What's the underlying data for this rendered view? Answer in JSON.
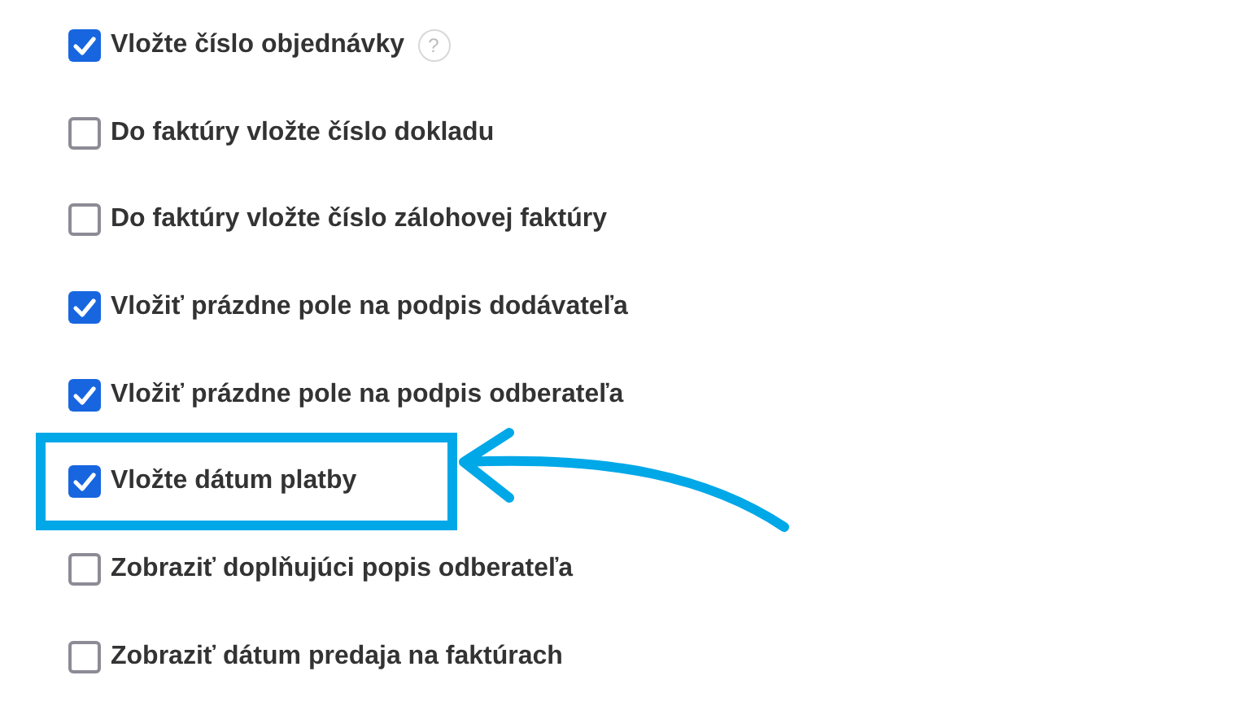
{
  "options": [
    {
      "label": "Vložte číslo objednávky",
      "checked": true,
      "help": "?",
      "highlighted": false
    },
    {
      "label": "Do faktúry vložte číslo dokladu",
      "checked": false,
      "highlighted": false
    },
    {
      "label": "Do faktúry vložte číslo zálohovej faktúry",
      "checked": false,
      "highlighted": false
    },
    {
      "label": "Vložiť prázdne pole na podpis dodávateľa",
      "checked": true,
      "highlighted": false
    },
    {
      "label": "Vložiť prázdne pole na podpis odberateľa",
      "checked": true,
      "highlighted": false
    },
    {
      "label": "Vložte dátum platby",
      "checked": true,
      "highlighted": true
    },
    {
      "label": "Zobraziť doplňujúci popis odberateľa",
      "checked": false,
      "highlighted": false
    },
    {
      "label": "Zobraziť dátum predaja na faktúrach",
      "checked": false,
      "highlighted": false
    }
  ]
}
